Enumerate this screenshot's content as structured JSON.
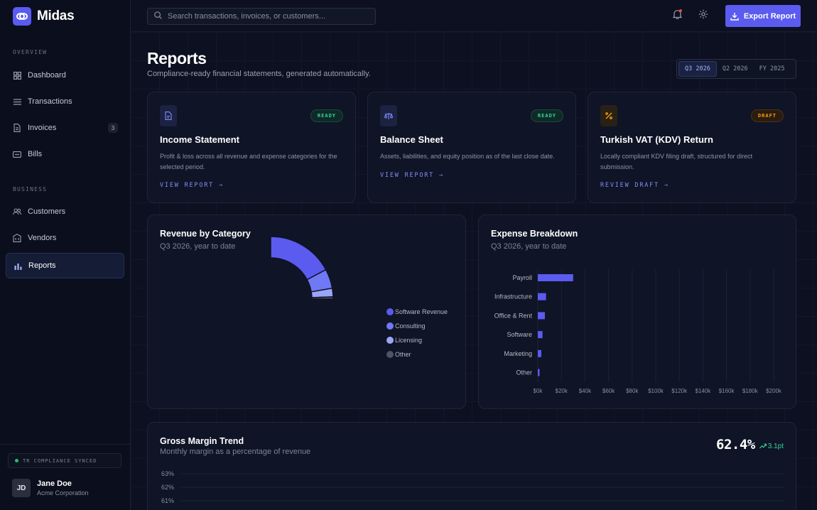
{
  "app": {
    "name": "Midas"
  },
  "search": {
    "placeholder": "Search transactions, invoices, or customers..."
  },
  "header": {
    "export_label": "Export Report"
  },
  "sidebar": {
    "sections": [
      {
        "label": "OVERVIEW",
        "items": [
          {
            "label": "Dashboard",
            "icon": "grid-icon"
          },
          {
            "label": "Transactions",
            "icon": "list-icon"
          },
          {
            "label": "Invoices",
            "icon": "document-icon",
            "badge": "3"
          },
          {
            "label": "Bills",
            "icon": "receipt-icon"
          }
        ]
      },
      {
        "label": "BUSINESS",
        "items": [
          {
            "label": "Customers",
            "icon": "users-icon"
          },
          {
            "label": "Vendors",
            "icon": "building-icon"
          },
          {
            "label": "Reports",
            "icon": "bar-chart-icon",
            "active": true
          }
        ]
      }
    ],
    "sync_status": "TR COMPLIANCE SYNCED",
    "user": {
      "initials": "JD",
      "name": "Jane Doe",
      "org": "Acme Corporation"
    }
  },
  "page": {
    "title": "Reports",
    "subtitle": "Compliance-ready financial statements, generated automatically.",
    "periods": [
      "Q3 2026",
      "Q2 2026",
      "FY 2025"
    ],
    "active_period": "Q3 2026"
  },
  "report_cards": [
    {
      "title": "Income Statement",
      "status": "READY",
      "icon": "file-icon",
      "description": "Profit & loss across all revenue and expense categories for the selected period.",
      "link": "VIEW REPORT →"
    },
    {
      "title": "Balance Sheet",
      "status": "READY",
      "icon": "scale-icon",
      "description": "Assets, liabilities, and equity position as of the last close date.",
      "link": "VIEW REPORT →"
    },
    {
      "title": "Turkish VAT (KDV) Return",
      "status": "DRAFT",
      "icon": "percent-icon",
      "description": "Locally compliant KDV filing draft, structured for direct submission.",
      "link": "REVIEW DRAFT →"
    }
  ],
  "revenue": {
    "title": "Revenue by Category",
    "subtitle": "Q3 2026, year to date"
  },
  "expense": {
    "title": "Expense Breakdown",
    "subtitle": "Q3 2026, year to date"
  },
  "gross_margin": {
    "title": "Gross Margin Trend",
    "subtitle": "Monthly margin as a percentage of revenue",
    "value": "62.4%",
    "delta": "3.1pt"
  },
  "colors": {
    "accent": "#5b5bf0",
    "ready": "#34d399",
    "draft": "#f59e0b",
    "positive": "#34d399"
  },
  "chart_data": [
    {
      "type": "pie",
      "title": "Revenue by Category",
      "categories": [
        "Software Revenue",
        "Consulting",
        "Licensing",
        "Other"
      ],
      "values": [
        62,
        18,
        8,
        2
      ],
      "colors": [
        "#5b5bf0",
        "#6f79f5",
        "#9aa6fb",
        "#4b5563"
      ],
      "legend": "right"
    },
    {
      "type": "bar",
      "orientation": "horizontal",
      "title": "Expense Breakdown",
      "categories": [
        "Payroll",
        "Infrastructure",
        "Office & Rent",
        "Software",
        "Marketing",
        "Other"
      ],
      "values": [
        30000,
        7000,
        6000,
        4000,
        3000,
        1500
      ],
      "xlim": [
        0,
        200000
      ],
      "xticks": [
        "$0k",
        "$20k",
        "$40k",
        "$60k",
        "$80k",
        "$100k",
        "$120k",
        "$140k",
        "$160k",
        "$180k",
        "$200k"
      ],
      "grid": true
    },
    {
      "type": "line",
      "title": "Gross Margin Trend",
      "yticks": [
        "63%",
        "62%",
        "61%"
      ],
      "x": [],
      "values": []
    }
  ]
}
